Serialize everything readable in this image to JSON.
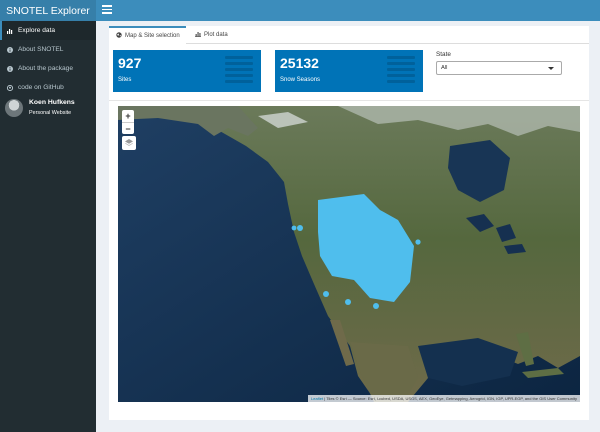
{
  "app": {
    "title": "SNOTEL Explorer"
  },
  "sidebar": {
    "items": [
      {
        "label": "Explore data",
        "icon": "bar-chart-icon"
      },
      {
        "label": "About SNOTEL",
        "icon": "info-icon"
      },
      {
        "label": "About the package",
        "icon": "info-icon"
      },
      {
        "label": "code on GitHub",
        "icon": "github-icon"
      }
    ],
    "user": {
      "name": "Koen Hufkens",
      "link": "Personal Website"
    }
  },
  "tabs": [
    {
      "label": "Map & Site selection",
      "icon": "globe-icon"
    },
    {
      "label": "Plot data",
      "icon": "bar-chart-icon"
    }
  ],
  "value_boxes": [
    {
      "value": "927",
      "label": "Sites"
    },
    {
      "value": "25132",
      "label": "Snow Seasons"
    }
  ],
  "state_select": {
    "label": "State",
    "value": "All"
  },
  "map": {
    "zoom_in": "+",
    "zoom_out": "−",
    "attribution_link": "Leaflet",
    "attribution_text": " | Tiles © Esri — Source: Esri, i-cubed, USDA, USGS, AEX, GeoEye, Getmapping, Aerogrid, IGN, IGP, UPR-EGP, and the GIS User Community"
  },
  "colors": {
    "brand": "#3c8dbc",
    "value_box": "#0073b7",
    "sidebar": "#222d32",
    "markers": "#4fc3f7"
  }
}
